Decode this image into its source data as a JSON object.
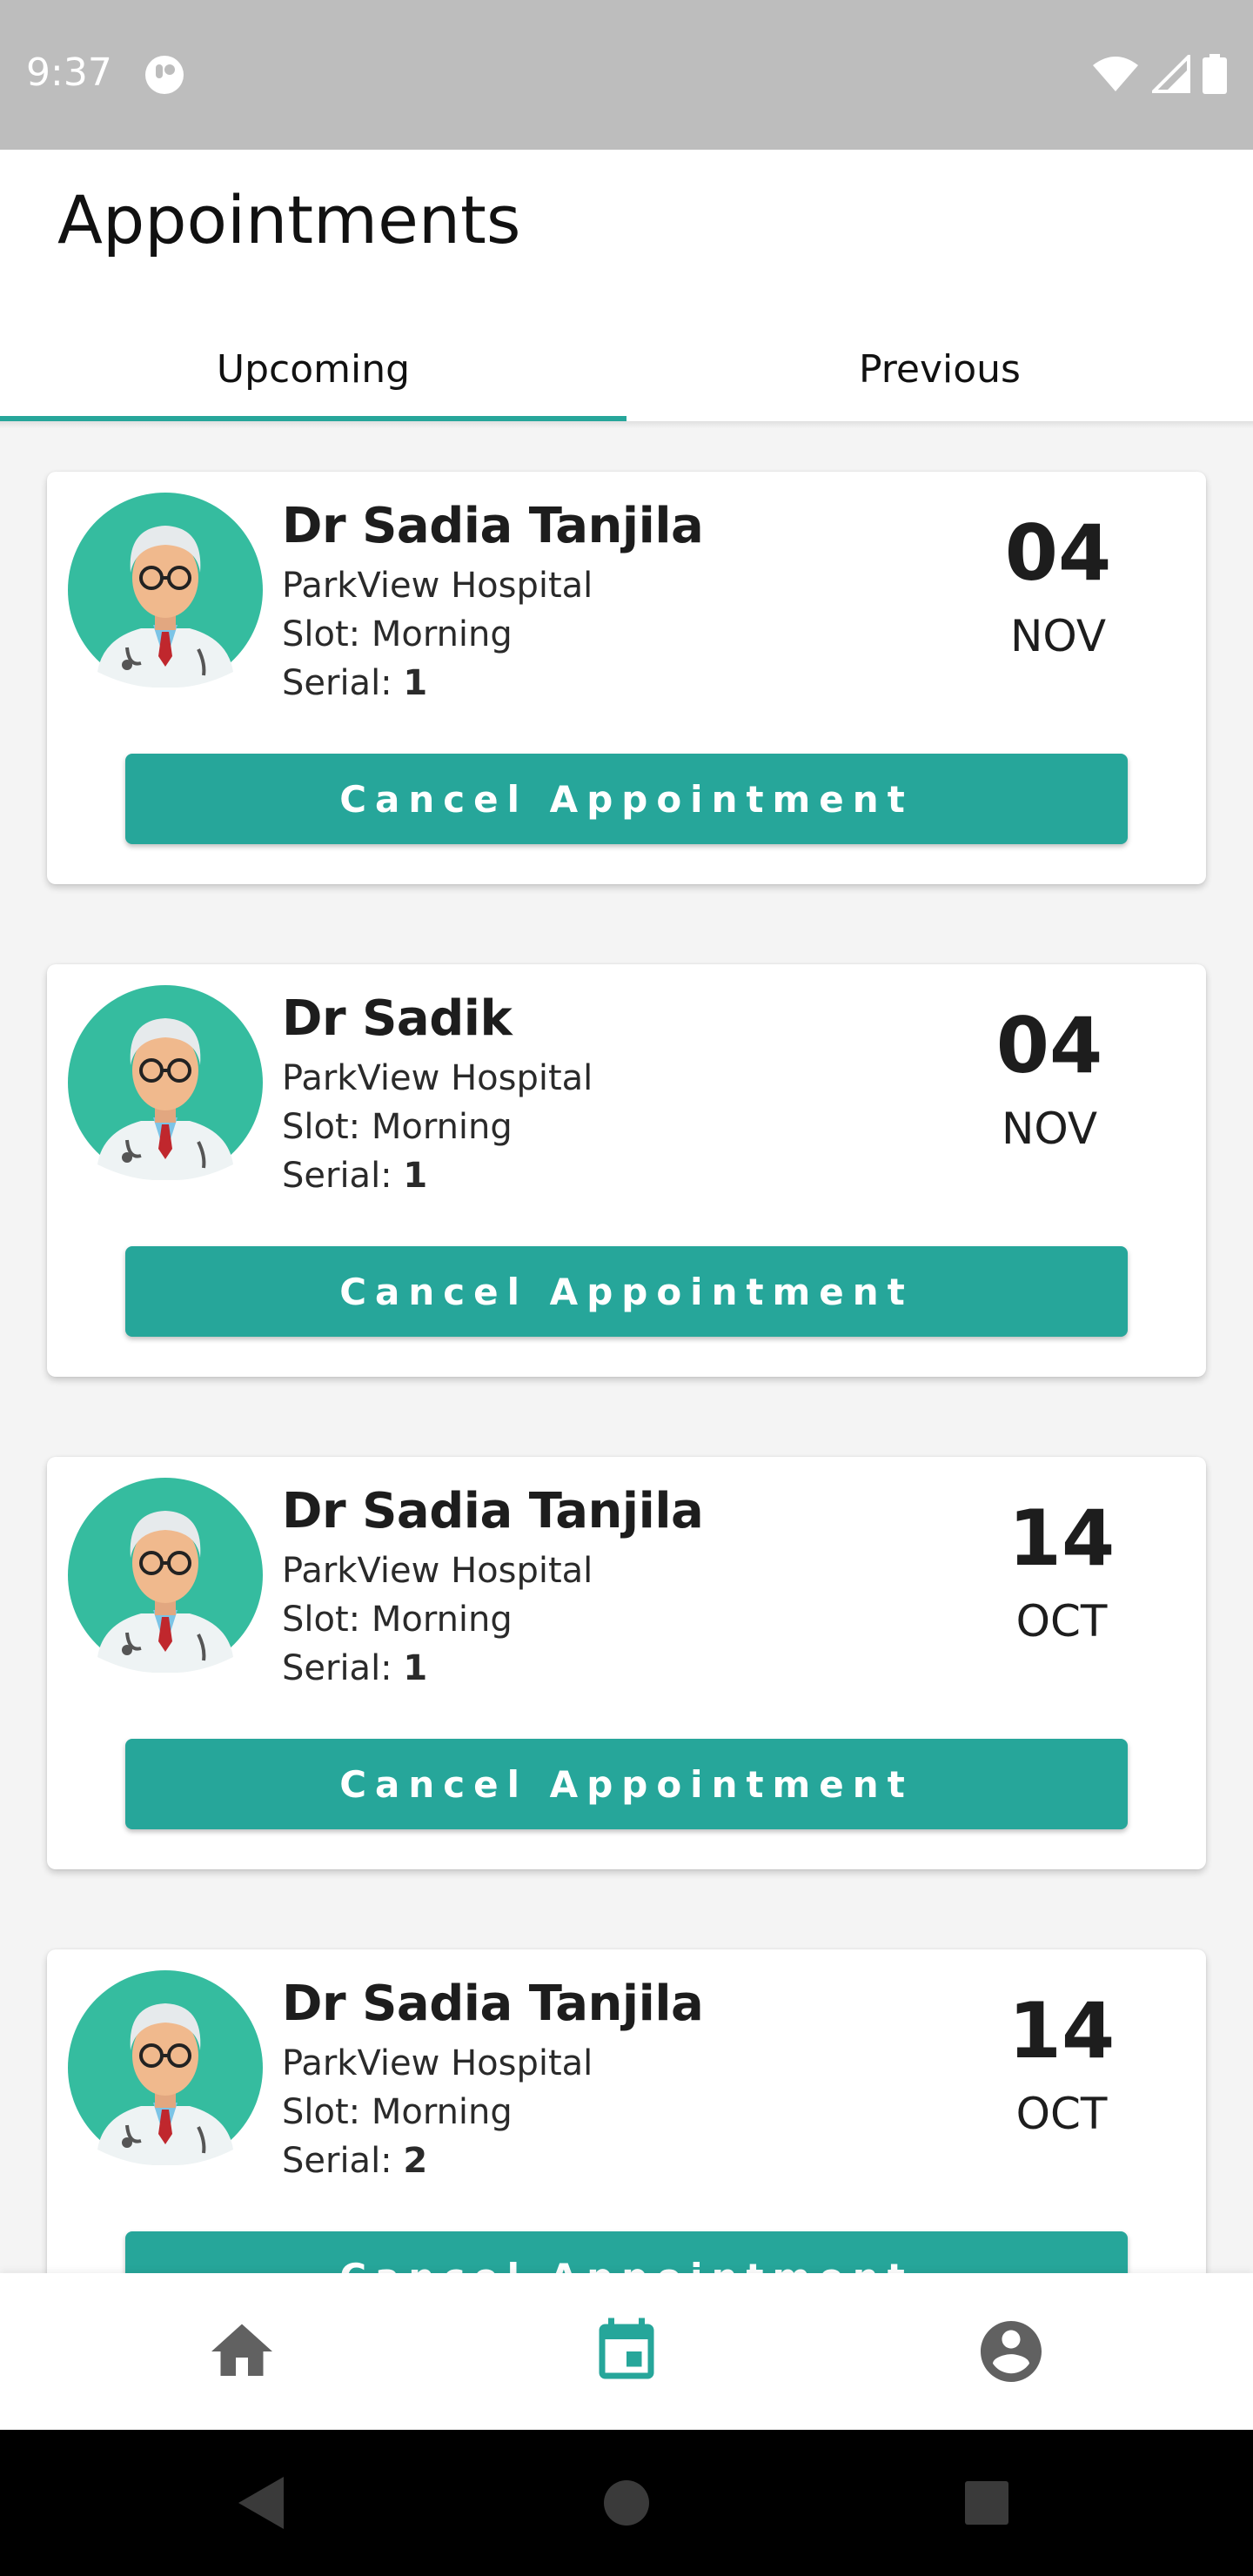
{
  "status_bar": {
    "time": "9:37"
  },
  "header": {
    "title": "Appointments"
  },
  "tabs": [
    {
      "label": "Upcoming",
      "active": true
    },
    {
      "label": "Previous",
      "active": false
    }
  ],
  "accent_color": "#26a69a",
  "serial_prefix": "Serial: ",
  "appointments": [
    {
      "doctor": "Dr Sadia Tanjila",
      "hospital": "ParkView Hospital",
      "slot": "Slot: Morning",
      "serial": "1",
      "day": "04",
      "month": "NOV",
      "button": "Cancel Appointment"
    },
    {
      "doctor": "Dr Sadik",
      "hospital": "ParkView Hospital",
      "slot": "Slot: Morning",
      "serial": "1",
      "day": "04",
      "month": "NOV",
      "button": "Cancel Appointment"
    },
    {
      "doctor": "Dr Sadia Tanjila",
      "hospital": "ParkView Hospital",
      "slot": "Slot: Morning",
      "serial": "1",
      "day": "14",
      "month": "OCT",
      "button": "Cancel Appointment"
    },
    {
      "doctor": "Dr Sadia Tanjila",
      "hospital": "ParkView Hospital",
      "slot": "Slot: Morning",
      "serial": "2",
      "day": "14",
      "month": "OCT",
      "button": "Cancel Appointment"
    }
  ],
  "bottom_nav": [
    {
      "icon": "home-icon",
      "active": false
    },
    {
      "icon": "calendar-icon",
      "active": true
    },
    {
      "icon": "account-icon",
      "active": false
    }
  ]
}
